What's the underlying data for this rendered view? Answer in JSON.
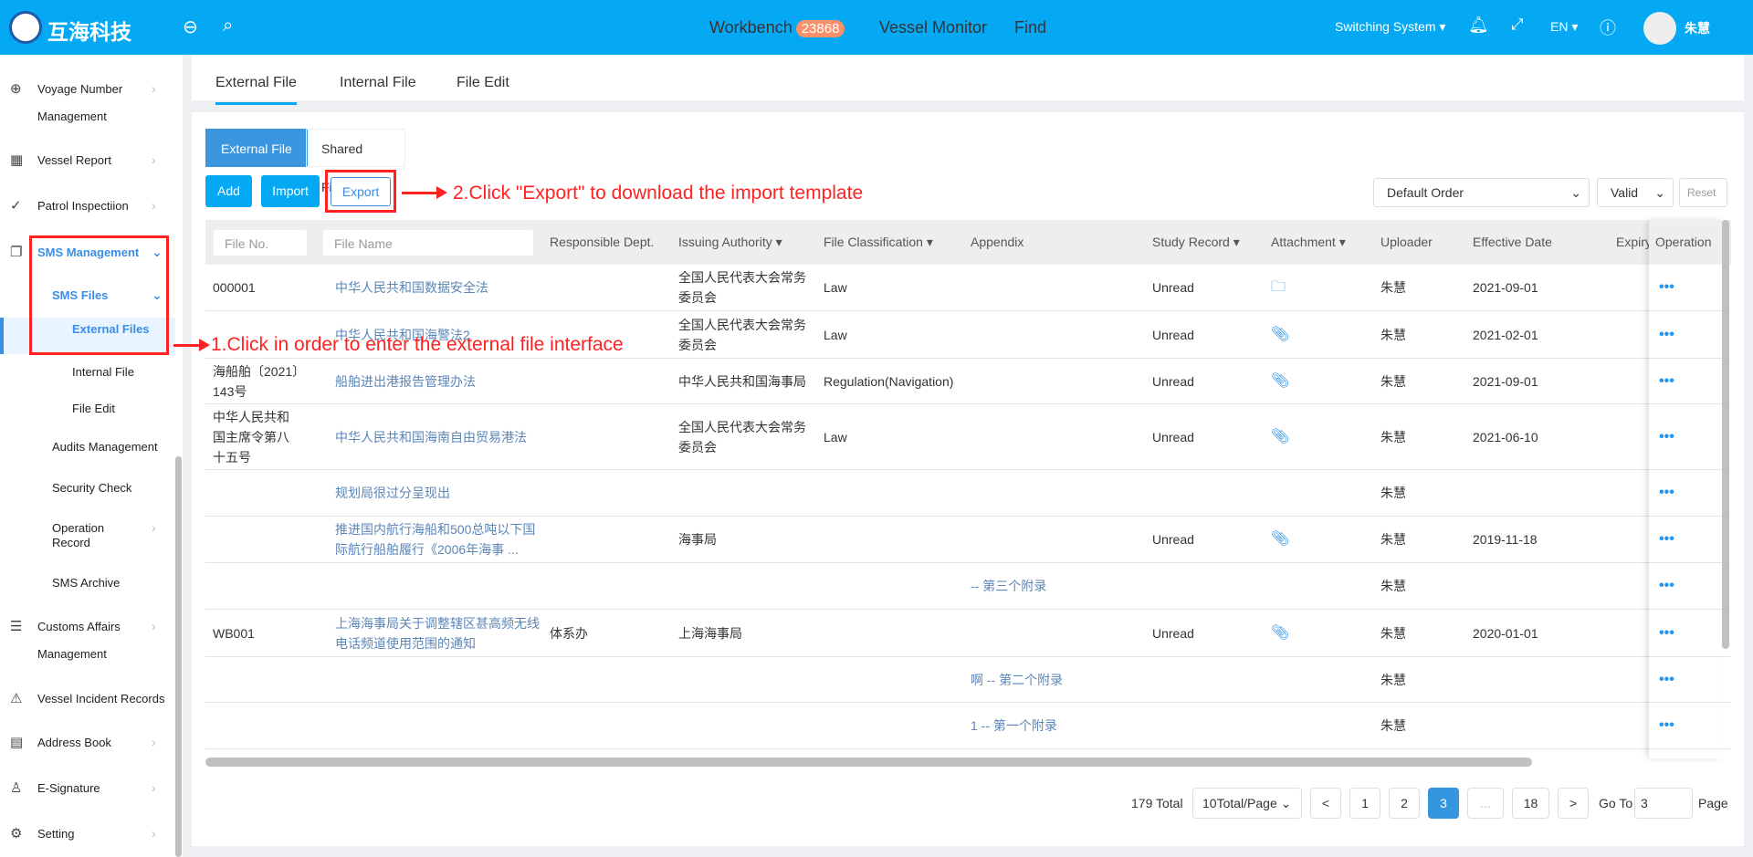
{
  "header": {
    "brand": "互海科技",
    "nav": [
      {
        "label": "Workbench",
        "badge": "23868"
      },
      {
        "label": "Vessel Monitor"
      },
      {
        "label": "Find"
      }
    ],
    "switch": "Switching System ▾",
    "lang": "EN ▾",
    "user": "朱慧"
  },
  "sidebar": {
    "items": [
      {
        "label": "Voyage Number",
        "label2": "Management",
        "icon": "globe-icon",
        "glyph": "⊕",
        "chev": true
      },
      {
        "label": "Vessel Report",
        "icon": "calendar-icon",
        "glyph": "▦",
        "chev": true
      },
      {
        "label": "Patrol Inspectiion",
        "icon": "check-circle-icon",
        "glyph": "✓",
        "chev": true
      },
      {
        "label": "SMS Management",
        "icon": "document-icon",
        "glyph": "❐",
        "chev": true,
        "active": true
      },
      {
        "label": "SMS Files",
        "sub": 1,
        "chev": true,
        "active": true
      },
      {
        "label": "External Files",
        "sub": 2,
        "active": true
      },
      {
        "label": "Internal File",
        "sub": 2
      },
      {
        "label": "File Edit",
        "sub": 2
      },
      {
        "label": "Audits Management",
        "sub": 1
      },
      {
        "label": "Security Check",
        "sub": 1
      },
      {
        "label": "Operation",
        "label2": "Record",
        "sub": 1,
        "chev": true
      },
      {
        "label": "SMS Archive",
        "sub": 1
      },
      {
        "label": "Customs Affairs",
        "label2": "Management",
        "icon": "signpost-icon",
        "glyph": "☰",
        "chev": true
      },
      {
        "label": "Vessel Incident Records",
        "icon": "warning-icon",
        "glyph": "⚠"
      },
      {
        "label": "Address Book",
        "icon": "address-book-icon",
        "glyph": "▤",
        "chev": true
      },
      {
        "label": "E-Signature",
        "icon": "stamp-icon",
        "glyph": "♙",
        "chev": true
      },
      {
        "label": "Setting",
        "icon": "gear-icon",
        "glyph": "⚙",
        "chev": true
      }
    ]
  },
  "tabs": [
    "External File",
    "Internal File",
    "File Edit"
  ],
  "subtabs": [
    "External File",
    "Shared Files"
  ],
  "toolbar": {
    "add": "Add",
    "import": "Import",
    "export": "Export",
    "order": "Default Order",
    "status": "Valid",
    "reset": "Reset"
  },
  "annotations": {
    "one": "1.Click in order to enter the external file interface",
    "two": "2.Click \"Export\" to download the import template"
  },
  "table": {
    "file_no_placeholder": "File No.",
    "file_name_placeholder": "File Name",
    "headers": [
      "Responsible Dept.",
      "Issuing Authority ▾",
      "File Classification ▾",
      "Appendix",
      "Study Record ▾",
      "Attachment ▾",
      "Uploader",
      "Effective Date",
      "Expiry D",
      "Operation"
    ],
    "rows": [
      {
        "no": "000001",
        "name": "中华人民共和国数据安全法",
        "dept": "",
        "auth": "全国人民代表大会常务委员会",
        "cls": "Law",
        "app": "",
        "study": "Unread",
        "att": "folder",
        "up": "朱慧",
        "eff": "2021-09-01"
      },
      {
        "no": "",
        "name": "中华人民共和国海警法2",
        "dept": "",
        "auth": "全国人民代表大会常务委员会",
        "cls": "Law",
        "app": "",
        "study": "Unread",
        "att": "clip",
        "up": "朱慧",
        "eff": "2021-02-01"
      },
      {
        "no": "海船舶〔2021〕143号",
        "name": "船舶进出港报告管理办法",
        "dept": "",
        "auth": "中华人民共和国海事局",
        "cls": "Regulation(Navigation)",
        "app": "",
        "study": "Unread",
        "att": "clip",
        "up": "朱慧",
        "eff": "2021-09-01"
      },
      {
        "no": "中华人民共和国主席令第八十五号",
        "name": "中华人民共和国海南自由贸易港法",
        "dept": "",
        "auth": "全国人民代表大会常务委员会",
        "cls": "Law",
        "app": "",
        "study": "Unread",
        "att": "clip",
        "up": "朱慧",
        "eff": "2021-06-10"
      },
      {
        "no": "",
        "name": "规划局很过分呈现出",
        "dept": "",
        "auth": "",
        "cls": "",
        "app": "",
        "study": "",
        "att": "",
        "up": "朱慧",
        "eff": ""
      },
      {
        "no": "",
        "name": "推进国内航行海船和500总吨以下国际航行船舶履行《2006年海事 ...",
        "dept": "",
        "auth": "海事局",
        "cls": "",
        "app": "",
        "study": "Unread",
        "att": "clip",
        "up": "朱慧",
        "eff": "2019-11-18"
      },
      {
        "no": "",
        "name": "",
        "dept": "",
        "auth": "",
        "cls": "",
        "app": "-- 第三个附录",
        "study": "",
        "att": "",
        "up": "朱慧",
        "eff": ""
      },
      {
        "no": "WB001",
        "name": "上海海事局关于调整辖区甚高频无线电话频道使用范围的通知",
        "dept": "体系办",
        "auth": "上海海事局",
        "cls": "",
        "app": "",
        "study": "Unread",
        "att": "clip",
        "up": "朱慧",
        "eff": "2020-01-01"
      },
      {
        "no": "",
        "name": "",
        "dept": "",
        "auth": "",
        "cls": "",
        "app": "啊 -- 第二个附录",
        "study": "",
        "att": "",
        "up": "朱慧",
        "eff": ""
      },
      {
        "no": "",
        "name": "",
        "dept": "",
        "auth": "",
        "cls": "",
        "app": "1 -- 第一个附录",
        "study": "",
        "att": "",
        "up": "朱慧",
        "eff": ""
      }
    ]
  },
  "pagination": {
    "total": "179 Total",
    "per_page": "10Total/Page",
    "prev": "<",
    "pages": [
      "1",
      "2",
      "3",
      "...",
      "18"
    ],
    "current": "3",
    "next": ">",
    "goto": "Go To",
    "goto_value": "3",
    "page": "Page"
  },
  "colors": {
    "header": "#05a9f3",
    "accent": "#3b8ee6",
    "annotation": "#ff2222"
  }
}
